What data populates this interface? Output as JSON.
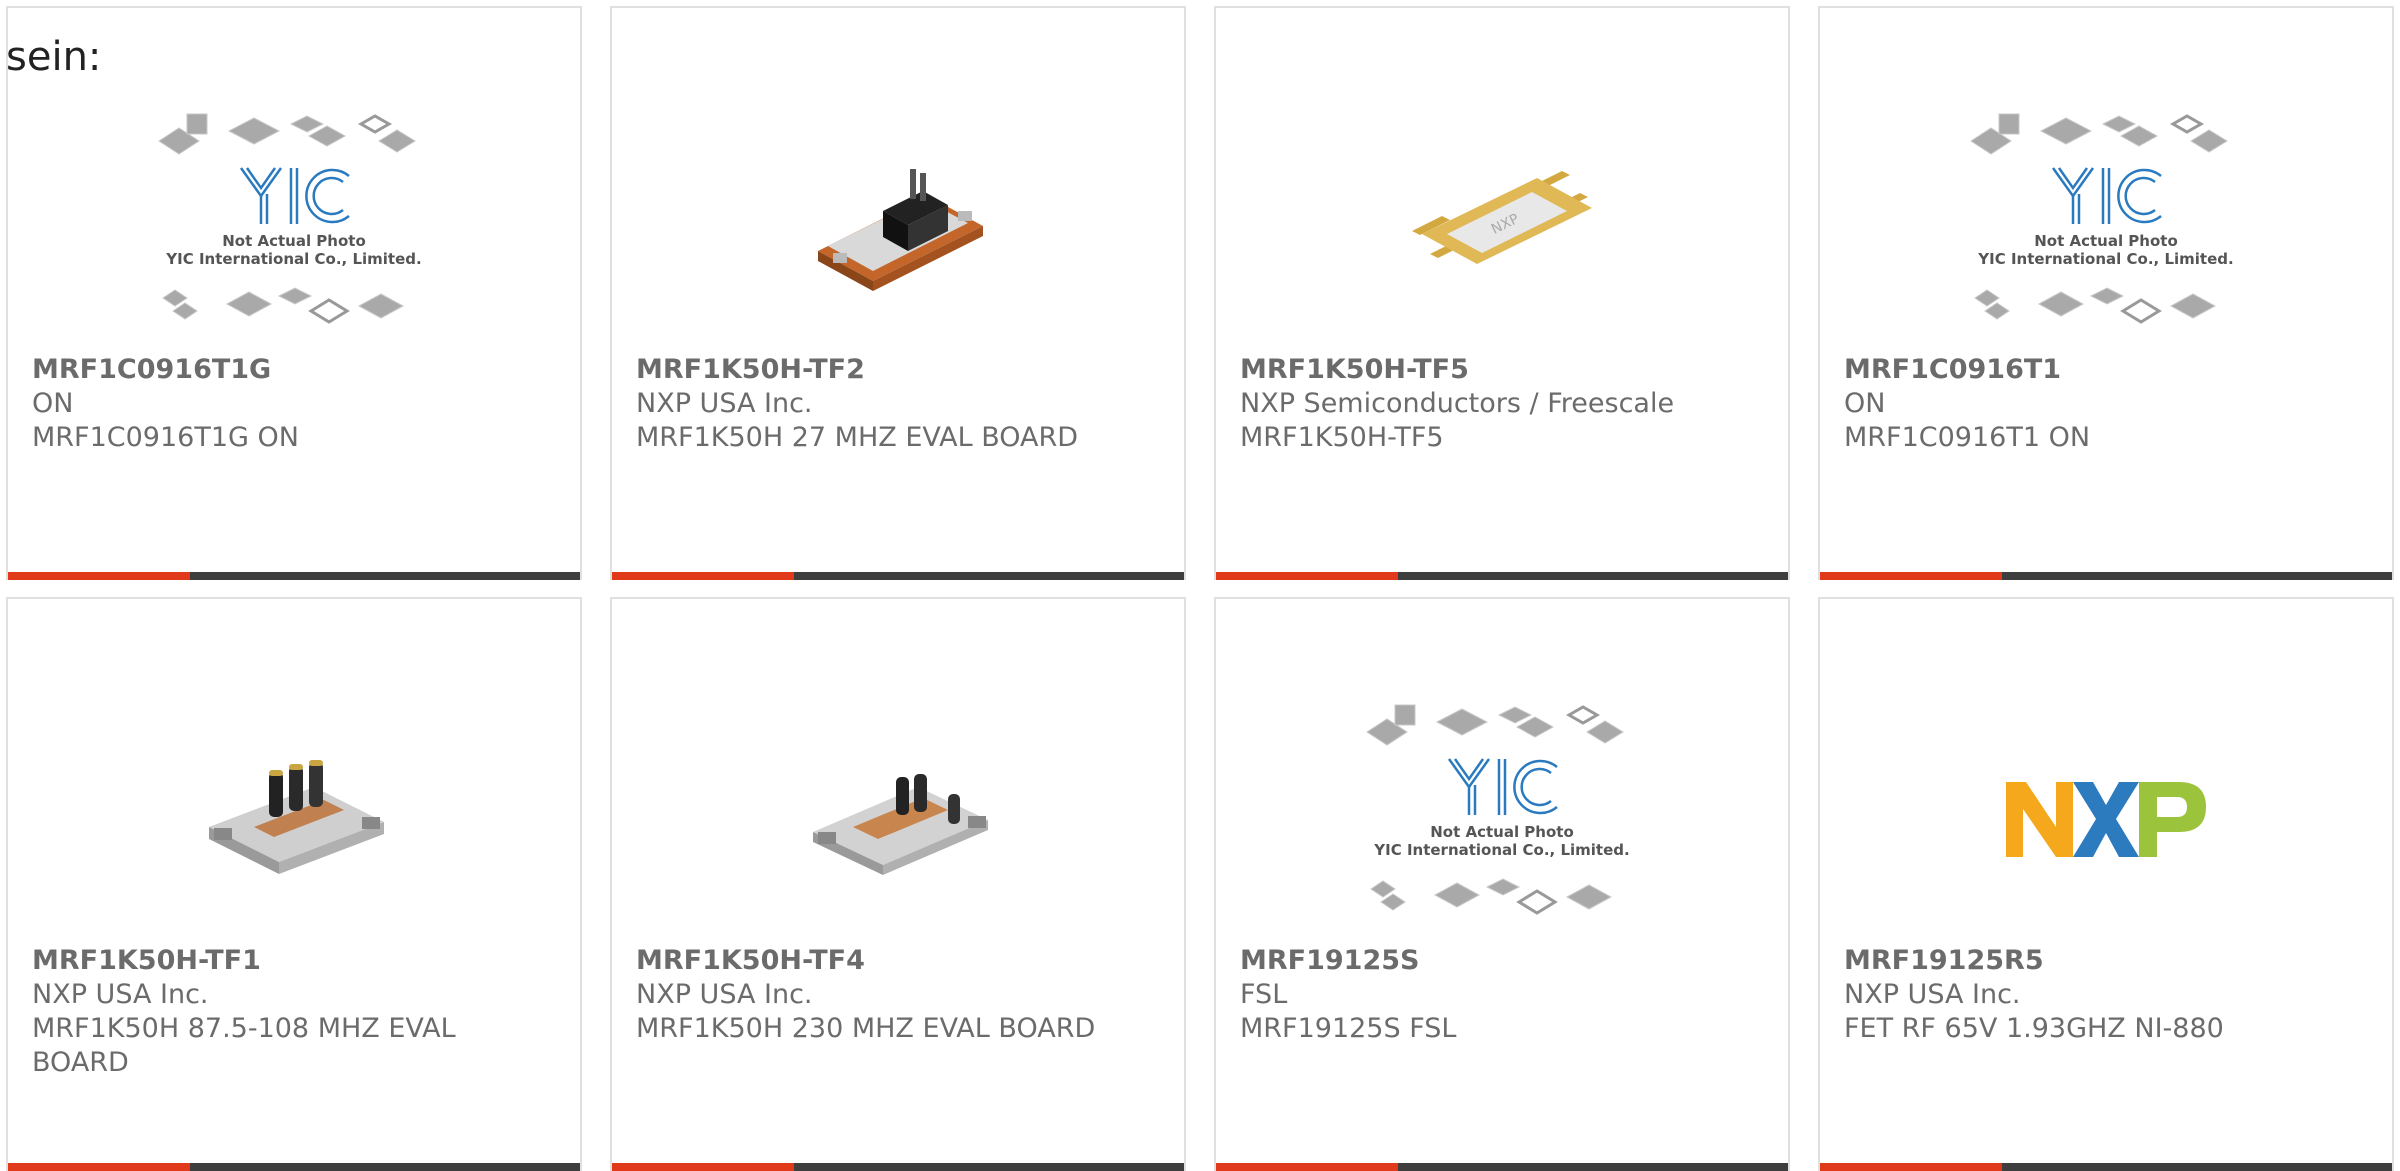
{
  "intro_text": "sein:",
  "colors": {
    "accent": "#e03a1a",
    "bar": "#3e3e3e",
    "text": "#666666"
  },
  "products": [
    {
      "part": "MRF1C0916T1G",
      "manufacturer": "ON",
      "description": "MRF1C0916T1G ON",
      "image": "placeholder",
      "placeholder": {
        "line1": "Not Actual Photo",
        "line2": "YIC International Co., Limited."
      }
    },
    {
      "part": "MRF1K50H-TF2",
      "manufacturer": "NXP USA Inc.",
      "description": "MRF1K50H 27 MHZ EVAL BOARD",
      "image": "eval-board-black"
    },
    {
      "part": "MRF1K50H-TF5",
      "manufacturer": "NXP Semiconductors / Freescale",
      "description": "MRF1K50H-TF5",
      "image": "rf-transistor-package"
    },
    {
      "part": "MRF1C0916T1",
      "manufacturer": "ON",
      "description": "MRF1C0916T1 ON",
      "image": "placeholder",
      "placeholder": {
        "line1": "Not Actual Photo",
        "line2": "YIC International Co., Limited."
      }
    },
    {
      "part": "MRF1K50H-TF1",
      "manufacturer": "NXP USA Inc.",
      "description": "MRF1K50H 87.5-108 MHZ EVAL BOARD",
      "image": "eval-board-capacitors"
    },
    {
      "part": "MRF1K50H-TF4",
      "manufacturer": "NXP USA Inc.",
      "description": "MRF1K50H 230 MHZ EVAL BOARD",
      "image": "eval-board-capacitors"
    },
    {
      "part": "MRF19125S",
      "manufacturer": "FSL",
      "description": "MRF19125S FSL",
      "image": "placeholder",
      "placeholder": {
        "line1": "Not Actual Photo",
        "line2": "YIC International Co., Limited."
      }
    },
    {
      "part": "MRF19125R5",
      "manufacturer": "NXP USA Inc.",
      "description": "FET RF 65V 1.93GHZ NI-880",
      "image": "nxp-logo",
      "logo_text": {
        "n": "N",
        "x": "X",
        "p": "P"
      }
    }
  ]
}
